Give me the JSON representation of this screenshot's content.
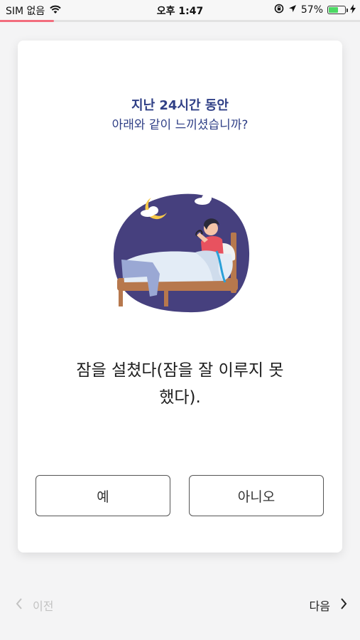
{
  "status_bar": {
    "carrier": "SIM 없음",
    "time": "오후 1:47",
    "battery_percent": "57%",
    "battery_level": 0.57,
    "icons": [
      "wifi-icon",
      "rotation-lock-icon",
      "location-arrow-icon",
      "battery-icon",
      "charging-bolt-icon"
    ]
  },
  "progress": {
    "fraction": 0.15,
    "color": "#f26d7d"
  },
  "card": {
    "heading_line1": "지난 24시간 동안",
    "heading_line2": "아래와 같이 느끼셨습니까?",
    "illustration": "person-sitting-in-bed-at-night-illustration",
    "question_line1": "잠을 설쳤다(잠을 잘 이루지 못",
    "question_line2": "했다).",
    "yes_label": "예",
    "no_label": "아니오"
  },
  "nav": {
    "prev_label": "이전",
    "next_label": "다음"
  },
  "colors": {
    "heading": "#2f3f86",
    "illustration_bg": "#46407e",
    "accent_red": "#e8525f",
    "background": "#f4f4f5"
  }
}
